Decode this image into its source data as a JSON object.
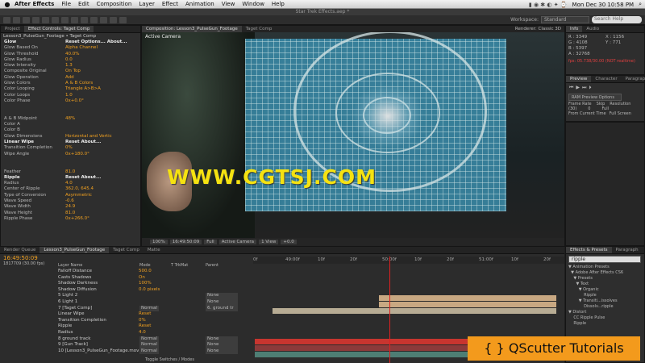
{
  "menubar": {
    "app": "After Effects",
    "items": [
      "File",
      "Edit",
      "Composition",
      "Layer",
      "Effect",
      "Animation",
      "View",
      "Window",
      "Help"
    ],
    "clock": "Mon Dec 30  10:58 PM",
    "search_icon": "magnifier"
  },
  "window": {
    "title": "Star Trek Effects.aep *"
  },
  "workspace": {
    "label": "Workspace:",
    "value": "Standard",
    "search_placeholder": "Search Help"
  },
  "effect_controls": {
    "tabs": [
      "Project",
      "Effect Controls: Taget Comp"
    ],
    "header": "Lesson3_PulseGun_Footage • Taget Comp",
    "rows": [
      {
        "k": "Glow",
        "v": "Reset  Options...  About...",
        "hd": true
      },
      {
        "k": "Glow Based On",
        "v": "Alpha Channel"
      },
      {
        "k": "Glow Threshold",
        "v": "40.0%"
      },
      {
        "k": "Glow Radius",
        "v": "0.0"
      },
      {
        "k": "Glow Intensity",
        "v": "1.3"
      },
      {
        "k": "Composite Original",
        "v": "On Top"
      },
      {
        "k": "Glow Operation",
        "v": "Add"
      },
      {
        "k": "Glow Colors",
        "v": "A & B Colors"
      },
      {
        "k": "Color Looping",
        "v": "Triangle A>B>A"
      },
      {
        "k": "Color Loops",
        "v": "1.0"
      },
      {
        "k": "Color Phase",
        "v": "0x+0.0°"
      },
      {
        "k": "",
        "v": ""
      },
      {
        "k": "",
        "v": ""
      },
      {
        "k": "A & B Midpoint",
        "v": "48%"
      },
      {
        "k": "Color A",
        "v": ""
      },
      {
        "k": "Color B",
        "v": ""
      },
      {
        "k": "Glow Dimensions",
        "v": "Horizontal and Vertic"
      },
      {
        "k": "Linear Wipe",
        "v": "Reset  About...",
        "hd": true
      },
      {
        "k": "Transition Completion",
        "v": "0%"
      },
      {
        "k": "Wipe Angle",
        "v": "0x+180.0°"
      },
      {
        "k": "",
        "v": ""
      },
      {
        "k": "",
        "v": ""
      },
      {
        "k": "Feather",
        "v": "81.0"
      },
      {
        "k": "Ripple",
        "v": "Reset  About...",
        "hd": true
      },
      {
        "k": "Radius",
        "v": "4.0"
      },
      {
        "k": "Center of Ripple",
        "v": "362.0, 645.4"
      },
      {
        "k": "Type of Conversion",
        "v": "Asymmetric"
      },
      {
        "k": "Wave Speed",
        "v": "-0.6"
      },
      {
        "k": "Wave Width",
        "v": "24.9"
      },
      {
        "k": "Wave Height",
        "v": "81.0"
      },
      {
        "k": "Ripple Phase",
        "v": "0x+266.0°"
      }
    ]
  },
  "composition": {
    "tabs": [
      "Composition: Lesson3_PulseGun_Footage",
      "Taget Comp"
    ],
    "renderer": "Renderer: Classic 3D",
    "camera_label": "Active Camera",
    "watermark": "WWW.CGTSJ.COM",
    "bottom_bar": [
      "100%",
      "16:49:50:09",
      "Full",
      "Active Camera",
      "1 View",
      "+0.0"
    ]
  },
  "info": {
    "tabs": [
      "Info",
      "Audio"
    ],
    "r": "R : 3349",
    "g": "G : 4108",
    "b": "B : 5397",
    "a": "A : 32768",
    "x": "X : 1156",
    "y": "Y : 771",
    "fps": "fps: 05.738/30.00 (NOT realtime)"
  },
  "preview": {
    "tabs": [
      "Preview",
      "Character",
      "Paragraph"
    ],
    "ram": "RAM Preview Options",
    "labels": [
      "Frame Rate",
      "Skip",
      "Resolution"
    ],
    "vals": [
      "(30)",
      "0",
      "Full"
    ],
    "from_current": "From Current Time",
    "full_screen": "Full Screen"
  },
  "effects_presets": {
    "tabs": [
      "Effects & Presets",
      "Paragraph"
    ],
    "search": "ripple",
    "tree": [
      "▼ Animation Presets",
      "  ▼ Adobe After Effects CS6",
      "    ▼ Presets",
      "      ▼ Text",
      "        ▼ Organic",
      "            Ripple",
      "        ▼ Transiti...issolves",
      "            Dissolv...ripple",
      "▼ Distort",
      "    CC Ripple Pulse",
      "    Ripple"
    ]
  },
  "timeline": {
    "tabs": [
      "Render Queue",
      "Lesson3_PulseGun_Footage",
      "Taget Comp",
      "Matte"
    ],
    "timecode": "16:49:50:09",
    "frame": "1817709 (30.00 fps)",
    "cols": [
      "Layer Name",
      "Mode",
      "T TrkMat",
      "Parent"
    ],
    "ruler": [
      "0f",
      "49:00f",
      "10f",
      "20f",
      "50:00f",
      "10f",
      "20f",
      "51:00f",
      "10f",
      "20f"
    ],
    "rows": [
      {
        "n": "Falloff Distance",
        "v": "500.0"
      },
      {
        "n": "Casts Shadows",
        "v": "On"
      },
      {
        "n": "Shadow Darkness",
        "v": "100%"
      },
      {
        "n": "Shadow Diffusion",
        "v": "0.0 pixels"
      },
      {
        "n": "5   Light 2",
        "mode": "",
        "par": "None"
      },
      {
        "n": "6   Light 1",
        "mode": "",
        "par": "None"
      },
      {
        "n": "7   [Taget Comp]",
        "mode": "Normal",
        "par": "6. ground tr"
      },
      {
        "n": "Linear Wipe",
        "v": "Reset"
      },
      {
        "n": "Transition Completion",
        "v": "0%"
      },
      {
        "n": "Ripple",
        "v": "Reset"
      },
      {
        "n": "Radius",
        "v": "4.0"
      },
      {
        "n": "8   ground track",
        "mode": "Normal",
        "par": "None"
      },
      {
        "n": "9   [Gun Track]",
        "mode": "Normal",
        "par": "None"
      },
      {
        "n": "10  [Lesson3_PulseGun_Footage.mov]",
        "mode": "Normal",
        "par": "None"
      }
    ],
    "footer": "Toggle Switches / Modes"
  },
  "overlay": {
    "text": "{ } QScutter Tutorials"
  }
}
